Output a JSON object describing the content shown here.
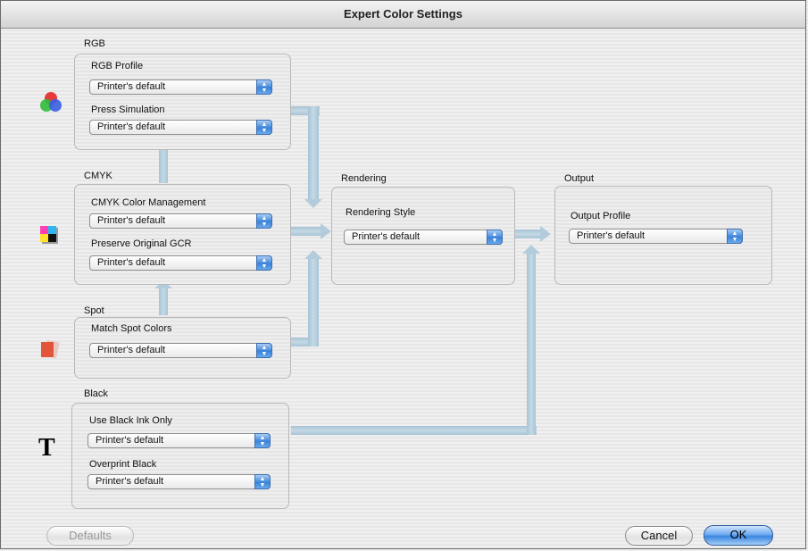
{
  "window": {
    "title": "Expert Color Settings"
  },
  "groups": {
    "rgb": {
      "label": "RGB",
      "icon": "rgb-circles-icon",
      "fields": [
        {
          "label": "RGB Profile",
          "value": "Printer's default"
        },
        {
          "label": "Press Simulation",
          "value": "Printer's default"
        }
      ]
    },
    "cmyk": {
      "label": "CMYK",
      "icon": "cmyk-swatch-icon",
      "fields": [
        {
          "label": "CMYK Color Management",
          "value": "Printer's default"
        },
        {
          "label": "Preserve Original GCR",
          "value": "Printer's default"
        }
      ]
    },
    "spot": {
      "label": "Spot",
      "icon": "spot-color-icon",
      "fields": [
        {
          "label": "Match Spot Colors",
          "value": "Printer's default"
        }
      ]
    },
    "black": {
      "label": "Black",
      "icon": "text-t-icon",
      "icon_text": "T",
      "fields": [
        {
          "label": "Use Black Ink Only",
          "value": "Printer's default"
        },
        {
          "label": "Overprint Black",
          "value": "Printer's default"
        }
      ]
    },
    "rendering": {
      "label": "Rendering",
      "fields": [
        {
          "label": "Rendering Style",
          "value": "Printer's default"
        }
      ]
    },
    "output": {
      "label": "Output",
      "fields": [
        {
          "label": "Output Profile",
          "value": "Printer's default"
        }
      ]
    }
  },
  "buttons": {
    "defaults": "Defaults",
    "cancel": "Cancel",
    "ok": "OK"
  },
  "colors": {
    "connector": "#b3ccdc",
    "ok_button": "#3b86e0"
  }
}
